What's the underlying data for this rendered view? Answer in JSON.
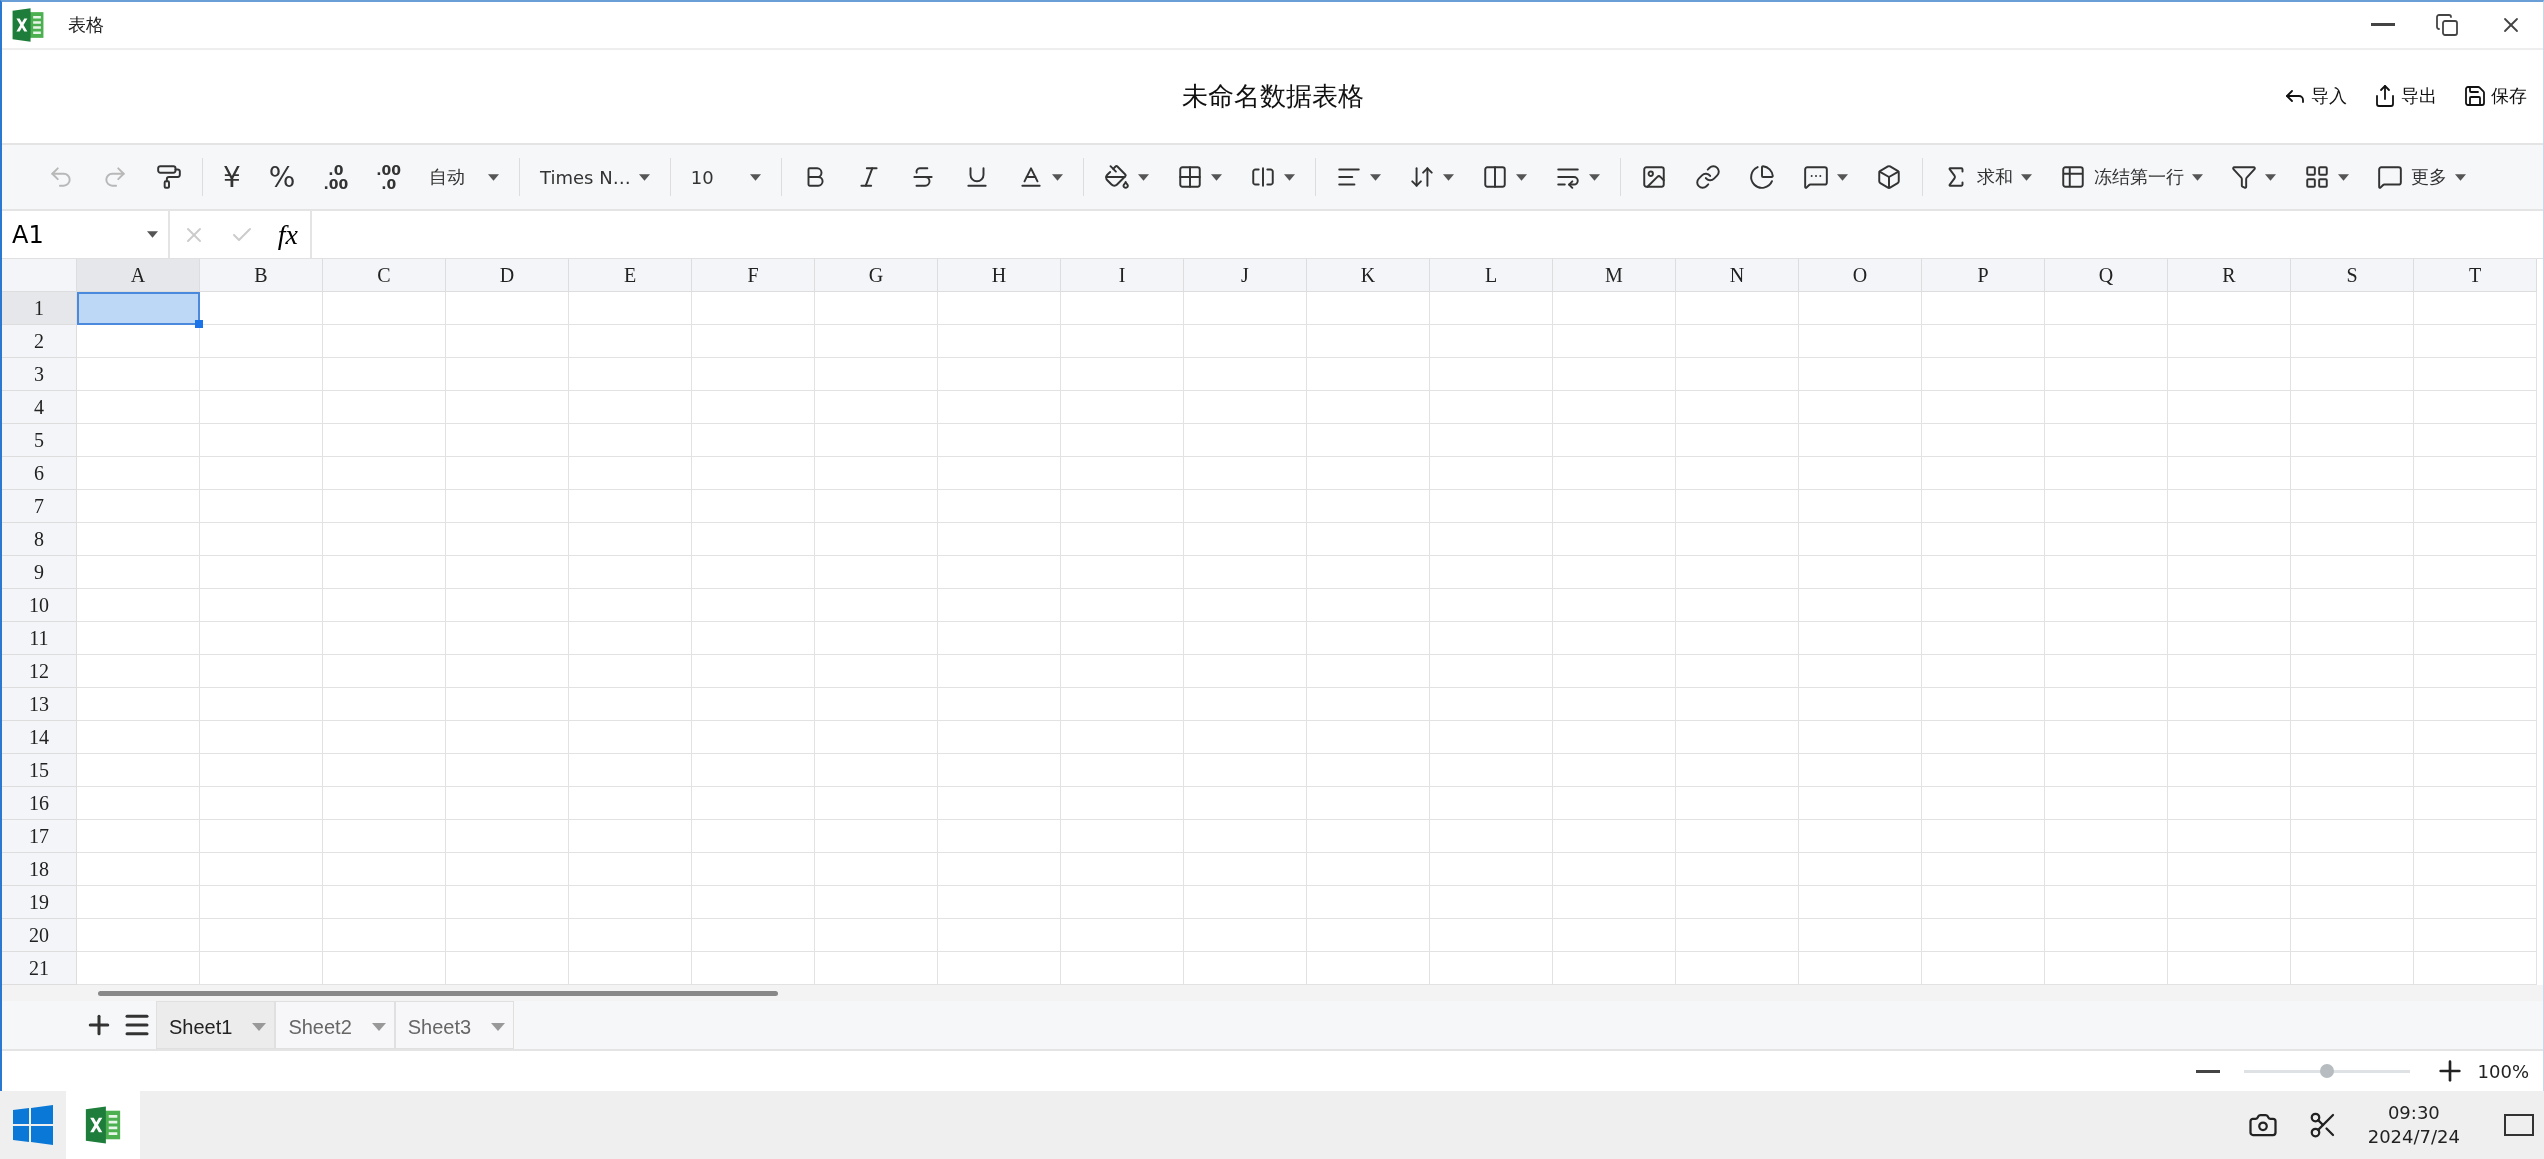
{
  "window": {
    "title": "表格",
    "controls": [
      {
        "kind": "minimize"
      },
      {
        "kind": "restore"
      },
      {
        "kind": "close"
      }
    ]
  },
  "header": {
    "title": "未命名数据表格",
    "actions": [
      {
        "kind": "import",
        "label": "导入"
      },
      {
        "kind": "export",
        "label": "导出"
      },
      {
        "kind": "save",
        "label": "保存"
      }
    ]
  },
  "toolbar": [
    [
      {
        "kind": "undo",
        "disabled": true,
        "dropdown": false
      },
      {
        "kind": "redo",
        "disabled": true,
        "dropdown": false
      },
      {
        "kind": "roller",
        "disabled": false,
        "dropdown": false
      }
    ],
    [
      {
        "kind": "text",
        "label": "¥",
        "disabled": false,
        "dropdown": false
      },
      {
        "kind": "text",
        "label": "%",
        "disabled": false,
        "dropdown": false
      },
      {
        "kind": "increase",
        "top": ".0",
        "bottom": ".00",
        "disabled": false,
        "dropdown": false
      },
      {
        "kind": "decrease",
        "top": ".00",
        "bottom": ".0",
        "disabled": false,
        "dropdown": false
      },
      {
        "kind": "select",
        "label": "自动",
        "disabled": false,
        "dropdown": true
      }
    ],
    [
      {
        "kind": "select",
        "label": "Times N…",
        "disabled": false,
        "dropdown": true
      }
    ],
    [
      {
        "kind": "select",
        "label": "10",
        "disabled": false,
        "dropdown": true
      }
    ],
    [
      {
        "kind": "bold",
        "disabled": false,
        "dropdown": false
      },
      {
        "kind": "italic",
        "disabled": false,
        "dropdown": false
      },
      {
        "kind": "strikethrough",
        "disabled": false,
        "dropdown": false
      },
      {
        "kind": "underline",
        "disabled": false,
        "dropdown": false
      },
      {
        "kind": "color",
        "disabled": false,
        "dropdown": true
      }
    ],
    [
      {
        "kind": "bucket",
        "disabled": false,
        "dropdown": true
      },
      {
        "kind": "border",
        "disabled": false,
        "dropdown": true
      },
      {
        "kind": "merge",
        "disabled": false,
        "dropdown": true
      }
    ],
    [
      {
        "kind": "align",
        "disabled": false,
        "dropdown": true
      },
      {
        "kind": "valign",
        "disabled": false,
        "dropdown": true
      },
      {
        "kind": "wrap",
        "disabled": false,
        "dropdown": true
      },
      {
        "kind": "rotate",
        "disabled": false,
        "dropdown": true
      }
    ],
    [
      {
        "kind": "image",
        "disabled": false,
        "dropdown": false
      },
      {
        "kind": "link",
        "disabled": false,
        "dropdown": false
      },
      {
        "kind": "chart",
        "disabled": false,
        "dropdown": false
      },
      {
        "kind": "comment",
        "disabled": false,
        "dropdown": true
      },
      {
        "kind": "cube",
        "disabled": false,
        "dropdown": false
      }
    ],
    [
      {
        "kind": "sum",
        "label": "求和",
        "disabled": false,
        "dropdown": true
      },
      {
        "kind": "freeze",
        "label": "冻结第一行",
        "disabled": false,
        "dropdown": true
      },
      {
        "kind": "filter",
        "disabled": false,
        "dropdown": true
      },
      {
        "kind": "hatch",
        "disabled": false,
        "dropdown": true
      },
      {
        "kind": "more",
        "label": "更多",
        "disabled": false,
        "dropdown": true
      }
    ]
  ],
  "formula_bar": {
    "name_box": "A1",
    "fx": "fx"
  },
  "grid": {
    "columns": [
      {
        "label": "A",
        "selected": true
      },
      {
        "label": "B",
        "selected": false
      },
      {
        "label": "C",
        "selected": false
      },
      {
        "label": "D",
        "selected": false
      },
      {
        "label": "E",
        "selected": false
      },
      {
        "label": "F",
        "selected": false
      },
      {
        "label": "G",
        "selected": false
      },
      {
        "label": "H",
        "selected": false
      },
      {
        "label": "I",
        "selected": false
      },
      {
        "label": "J",
        "selected": false
      },
      {
        "label": "K",
        "selected": false
      },
      {
        "label": "L",
        "selected": false
      },
      {
        "label": "M",
        "selected": false
      },
      {
        "label": "N",
        "selected": false
      },
      {
        "label": "O",
        "selected": false
      },
      {
        "label": "P",
        "selected": false
      },
      {
        "label": "Q",
        "selected": false
      },
      {
        "label": "R",
        "selected": false
      },
      {
        "label": "S",
        "selected": false
      },
      {
        "label": "T",
        "selected": false
      }
    ],
    "rows": [
      {
        "label": "1",
        "selected": true
      },
      {
        "label": "2",
        "selected": false
      },
      {
        "label": "3",
        "selected": false
      },
      {
        "label": "4",
        "selected": false
      },
      {
        "label": "5",
        "selected": false
      },
      {
        "label": "6",
        "selected": false
      },
      {
        "label": "7",
        "selected": false
      },
      {
        "label": "8",
        "selected": false
      },
      {
        "label": "9",
        "selected": false
      },
      {
        "label": "10",
        "selected": false
      },
      {
        "label": "11",
        "selected": false
      },
      {
        "label": "12",
        "selected": false
      },
      {
        "label": "13",
        "selected": false
      },
      {
        "label": "14",
        "selected": false
      },
      {
        "label": "15",
        "selected": false
      },
      {
        "label": "16",
        "selected": false
      },
      {
        "label": "17",
        "selected": false
      },
      {
        "label": "18",
        "selected": false
      },
      {
        "label": "19",
        "selected": false
      },
      {
        "label": "20",
        "selected": false
      },
      {
        "label": "21",
        "selected": false
      }
    ]
  },
  "sheets": [
    {
      "label": "Sheet1",
      "selected": true
    },
    {
      "label": "Sheet2",
      "selected": false
    },
    {
      "label": "Sheet3",
      "selected": false
    }
  ],
  "zoom": {
    "level": 0.5,
    "reading": "100%"
  },
  "taskbar": {
    "apps": [
      {
        "kind": "windows",
        "selected": false
      },
      {
        "kind": "spreadsheet",
        "selected": true
      }
    ],
    "tray": [
      {
        "kind": "camera"
      },
      {
        "kind": "scissors"
      }
    ],
    "time": "09:30",
    "date": "2024/7/24"
  }
}
